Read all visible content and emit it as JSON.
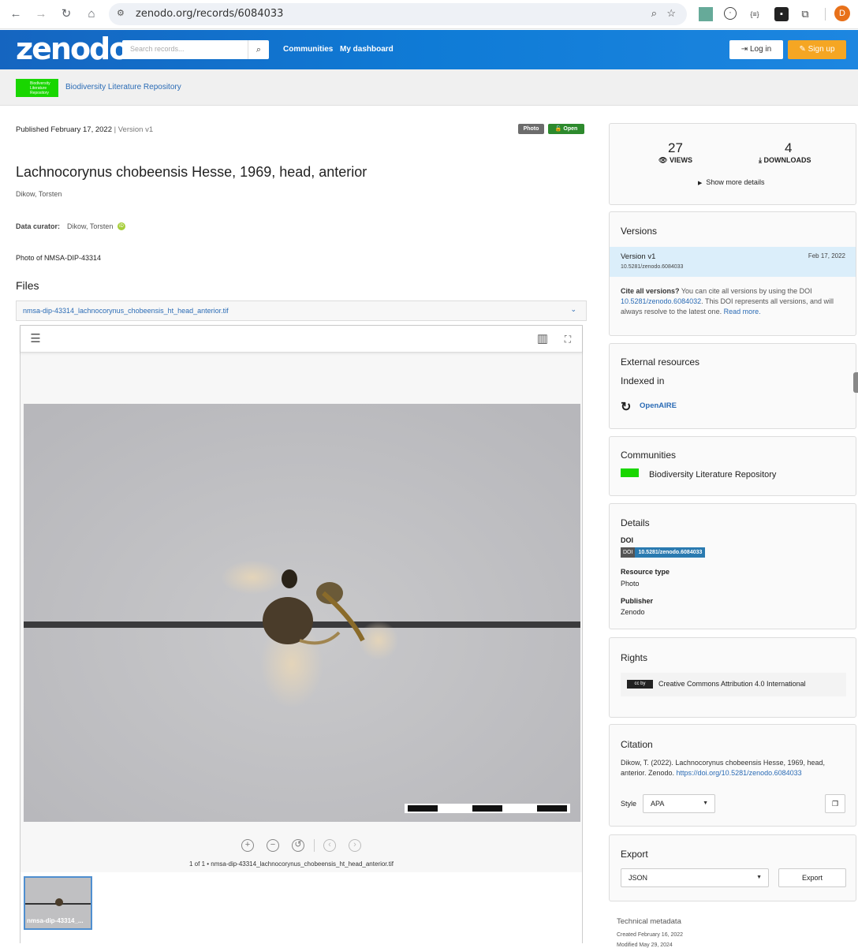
{
  "browser": {
    "url": "zenodo.org/records/6084033",
    "profile_initial": "D"
  },
  "header": {
    "logo": "zenodo",
    "search_placeholder": "Search records...",
    "links": [
      "Communities",
      "My dashboard"
    ],
    "login": "Log in",
    "signup": "Sign up"
  },
  "community_bar": {
    "name": "Biodiversity Literature Repository",
    "logo_text": "Biodiversity Literature Repository"
  },
  "record": {
    "published": "Published February 17, 2022",
    "version": "Version v1",
    "badges": [
      "Photo",
      "Open"
    ],
    "title": "Lachnocorynus chobeensis Hesse, 1969, head, anterior",
    "creator": "Dikow, Torsten",
    "curator_label": "Data curator:",
    "curator": "Dikow, Torsten",
    "description": "Photo of NMSA-DIP-43314",
    "files_heading": "Files",
    "file_name": "nmsa-dip-43314_lachnocorynus_chobeensis_ht_head_anterior.tif",
    "viewer_caption": "1 of 1 • nmsa-dip-43314_lachnocorynus_chobeensis_ht_head_anterior.tif",
    "thumb_label": "nmsa-dip-43314_..."
  },
  "stats": {
    "views": "27",
    "views_label": "VIEWS",
    "downloads": "4",
    "downloads_label": "DOWNLOADS",
    "more": "Show more details"
  },
  "versions": {
    "title": "Versions",
    "item": "Version v1",
    "date": "Feb 17, 2022",
    "doi": "10.5281/zenodo.6084033",
    "cite_bold": "Cite all versions?",
    "cite_text": " You can cite all versions by using the DOI ",
    "cite_doi": "10.5281/zenodo.6084032",
    "cite_text2": ". This DOI represents all versions, and will always resolve to the latest one. ",
    "read_more": "Read more."
  },
  "external": {
    "title": "External resources",
    "indexed": "Indexed in",
    "openaire": "OpenAIRE"
  },
  "communities": {
    "title": "Communities",
    "name": "Biodiversity Literature Repository"
  },
  "details": {
    "title": "Details",
    "doi_label": "DOI",
    "doi_tag": "DOI",
    "doi": "10.5281/zenodo.6084033",
    "rt_label": "Resource type",
    "rt": "Photo",
    "pub_label": "Publisher",
    "pub": "Zenodo"
  },
  "rights": {
    "title": "Rights",
    "license": "Creative Commons Attribution 4.0 International",
    "cc": "cc by"
  },
  "citation": {
    "title": "Citation",
    "text": "Dikow, T. (2022). Lachnocorynus chobeensis Hesse, 1969, head, anterior. Zenodo. ",
    "url": "https://doi.org/10.5281/zenodo.6084033",
    "style_label": "Style",
    "style": "APA"
  },
  "export": {
    "title": "Export",
    "format": "JSON",
    "button": "Export"
  },
  "technical": {
    "title": "Technical metadata",
    "created": "Created February 16, 2022",
    "modified": "Modified May 29, 2024"
  },
  "colors": {
    "header": "#1565c0",
    "signup": "#f5a623",
    "badge_photo": "#6c6c6c",
    "badge_open": "#2d8a2d",
    "doi_badge": "#2a7ab0"
  }
}
